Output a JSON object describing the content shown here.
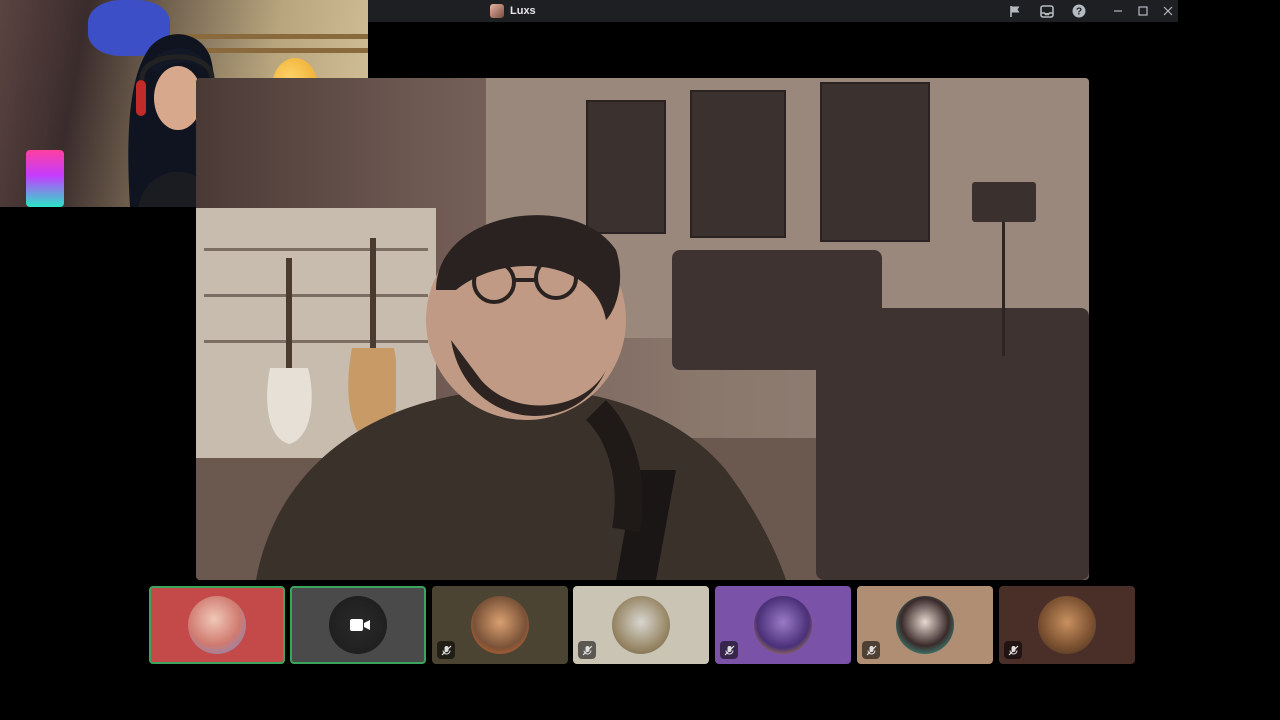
{
  "window": {
    "title": "Luxs"
  },
  "titlebar_buttons": [
    {
      "name": "flag-icon"
    },
    {
      "name": "inbox-icon"
    },
    {
      "name": "help-icon"
    },
    {
      "name": "minimize-icon"
    },
    {
      "name": "maximize-icon"
    },
    {
      "name": "close-icon"
    }
  ],
  "colors": {
    "speaking_border": "#3ba55d",
    "titlebar_bg": "#1e1f22",
    "icon_muted": "#b5bac1"
  },
  "participants": [
    {
      "id": "p1",
      "tile_color": "#c44a4a",
      "speaking": true,
      "muted": false,
      "camera_off_icon": false
    },
    {
      "id": "p2",
      "tile_color": "#4a4a4a",
      "speaking": true,
      "muted": false,
      "camera_off_icon": true
    },
    {
      "id": "p3",
      "tile_color": "#4b4432",
      "speaking": false,
      "muted": true,
      "camera_off_icon": false
    },
    {
      "id": "p4",
      "tile_color": "#c9c4b4",
      "speaking": false,
      "muted": true,
      "camera_off_icon": false
    },
    {
      "id": "p5",
      "tile_color": "#7a52a8",
      "speaking": false,
      "muted": true,
      "camera_off_icon": false
    },
    {
      "id": "p6",
      "tile_color": "#b08e74",
      "speaking": false,
      "muted": true,
      "camera_off_icon": false
    },
    {
      "id": "p7",
      "tile_color": "#4a2e28",
      "speaking": false,
      "muted": true,
      "camera_off_icon": false
    }
  ]
}
